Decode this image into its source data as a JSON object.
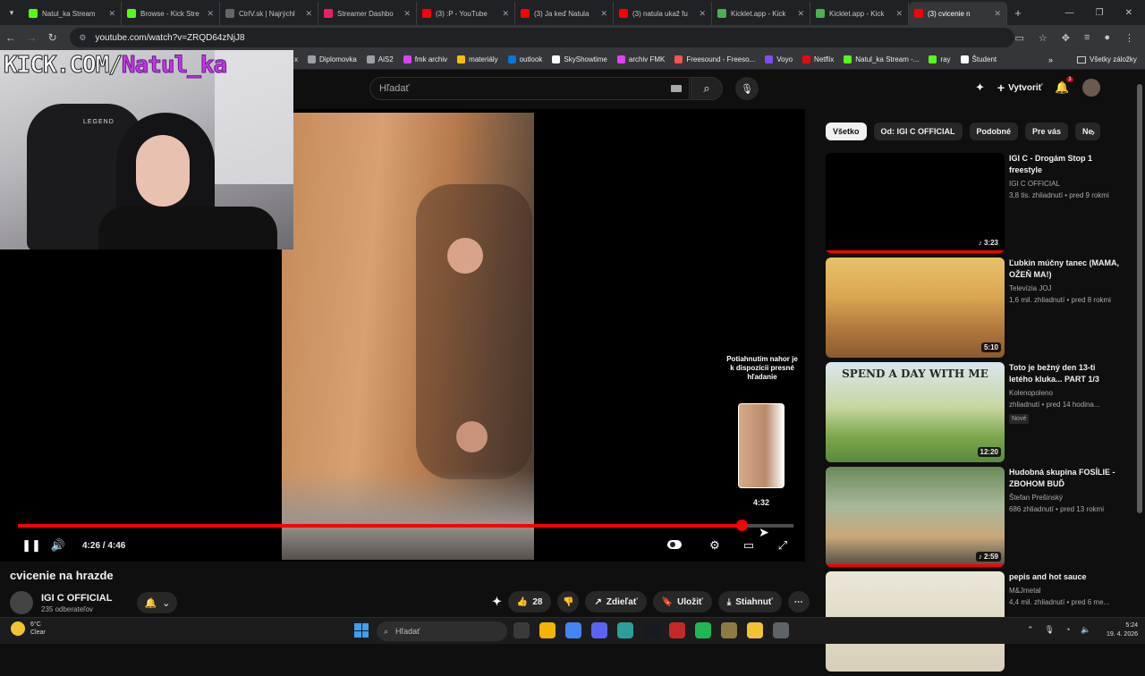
{
  "browser": {
    "tabs": [
      {
        "label": "Natul_ka Stream",
        "color": "#53fc18"
      },
      {
        "label": "Browse - Kick Stre",
        "color": "#53fc18"
      },
      {
        "label": "CtrlV.sk | Najrýchl",
        "color": "#666666"
      },
      {
        "label": "Streamer Dashbo",
        "color": "#e91e63"
      },
      {
        "label": "(3) :P - YouTube",
        "color": "#ff0000"
      },
      {
        "label": "(3) Ja keď Natula",
        "color": "#ff0000"
      },
      {
        "label": "(3) natula ukaž fu",
        "color": "#ff0000"
      },
      {
        "label": "Kicklet.app - Kick",
        "color": "#4caf50"
      },
      {
        "label": "Kicklet.app - Kick",
        "color": "#4caf50"
      },
      {
        "label": "(3) cvicenie n",
        "color": "#ff0000",
        "active": true
      }
    ],
    "url": "youtube.com/watch?v=ZRQD64zNjJ8",
    "bookmarks": [
      {
        "label": "Diplomovka",
        "color": "#9aa0a6"
      },
      {
        "label": "AiS2",
        "color": "#9aa0a6"
      },
      {
        "label": "fmk archiv",
        "color": "#e040fb"
      },
      {
        "label": "materiály",
        "color": "#fbbc04"
      },
      {
        "label": "outlook",
        "color": "#0078d4"
      },
      {
        "label": "SkyShowtime",
        "color": "#ffffff"
      },
      {
        "label": "archiv FMK",
        "color": "#e040fb"
      },
      {
        "label": "Freesound - Freeso...",
        "color": "#ff5252"
      },
      {
        "label": "Voyo",
        "color": "#7c4dff"
      },
      {
        "label": "Netflix",
        "color": "#e50914"
      },
      {
        "label": "Natul_ka Stream -...",
        "color": "#53fc18"
      },
      {
        "label": "ray",
        "color": "#53fc18"
      },
      {
        "label": "Študent",
        "color": "#ffffff"
      }
    ],
    "bookmarks_more": "»",
    "all_bookmarks": "Všetky záložky",
    "stray_char": "x"
  },
  "youtube": {
    "search_placeholder": "Hľadať",
    "create_label": "Vytvoriť",
    "notification_count": "3"
  },
  "stream_overlay": {
    "prefix": "KICK.COM/",
    "handle": "Natul_ka"
  },
  "player": {
    "current_time": "4:26",
    "duration": "4:46",
    "time_display": "4:26 / 4:46",
    "played_fraction": 0.933,
    "hover_hint": "Potiahnutím nahor je k dispozícii presné hľadanie",
    "hover_time": "4:32"
  },
  "video": {
    "title": "cvicenie na hrazde",
    "channel": "IGI C OFFICIAL",
    "subscribers": "235 odberateľov",
    "likes": "28",
    "share_label": "Zdieľať",
    "save_label": "Uložiť",
    "download_label": "Stiahnuť"
  },
  "sidebar": {
    "chips": [
      {
        "label": "Všetko",
        "active": true
      },
      {
        "label": "Od: IGI C OFFICIAL"
      },
      {
        "label": "Podobné"
      },
      {
        "label": "Pre vás"
      },
      {
        "label": "Ne"
      }
    ],
    "recommendations": [
      {
        "title": "IGI C - Drogám Stop 1 freestyle",
        "channel": "IGI C OFFICIAL",
        "meta": "3,8 tis. zhliadnutí • pred 9 rokmi",
        "duration": "♪ 3:23",
        "progress": 1.0,
        "thumb": "linear-gradient(#000,#000)"
      },
      {
        "title": "Ľubkin múčny tanec (MAMA, OŽEŇ MA!)",
        "channel": "Televízia JOJ",
        "meta": "1,6 mil. zhliadnutí • pred 8 rokmi",
        "duration": "5:10",
        "progress": 0,
        "thumb": "linear-gradient(180deg,#e8c26a 0%,#d9a550 40%,#b47a3d 70%,#8a5a2e 100%)"
      },
      {
        "title": "Toto je bežný den 13-ti letého kluka... PART 1/3",
        "channel": "Kolenopoleno",
        "meta": "zhliadnutí • pred 14 hodina...",
        "badge": "Nové",
        "thumb_text": "SPEND A DAY WITH ME",
        "duration": "12:20",
        "progress": 0,
        "thumb": "linear-gradient(180deg,#dbe6ef 0%,#c7d6a0 45%,#7ba64a 75%,#5a8a3a 100%)"
      },
      {
        "title": "Hudobná skupina FOSÍLIE - ZBOHOM BUĎ",
        "channel": "Štefan Prešinský",
        "meta": "686 zhliadnutí • pred 13 rokmi",
        "duration": "♪ 2:59",
        "progress": 1.0,
        "thumb": "linear-gradient(180deg,#6a8a5a 0%,#a9b89a 40%,#c9a77a 70%,#4a4a44 100%)"
      },
      {
        "title": "pepis and hot sauce",
        "channel": "M&Jmetal",
        "meta": "4,4 mil. zhliadnutí • pred 6 me...",
        "duration": "",
        "progress": 0,
        "thumb": "linear-gradient(180deg,#eae6d8 0%,#d8cfb8 100%)"
      }
    ]
  },
  "taskbar": {
    "temperature": "6°C",
    "weather": "Clear",
    "search_placeholder": "Hľadať",
    "time": "5:24",
    "date": "19. 4. 2026",
    "apps": [
      "#3a3a3a",
      "#f4b400",
      "#4285f4",
      "#5865f2",
      "#2aa198",
      "#171a21",
      "#c62828",
      "#1db954",
      "#8e7b3f",
      "#f1c232",
      "#5f6368"
    ]
  }
}
